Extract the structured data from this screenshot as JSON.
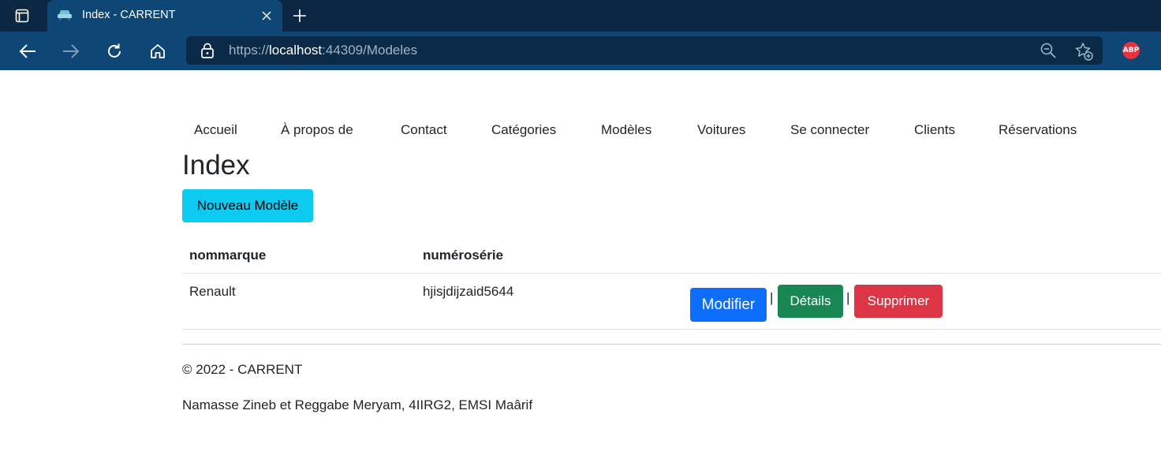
{
  "browser": {
    "tab_title": "Index - CARRENT",
    "url_scheme": "https://",
    "url_host": "localhost",
    "url_rest": ":44309/Modeles",
    "abp_label": "ABP",
    "icons": [
      "tab-actions-icon",
      "car-favicon-icon",
      "close-icon",
      "plus-icon",
      "back-arrow-icon",
      "forward-arrow-icon",
      "refresh-icon",
      "home-icon",
      "lock-icon",
      "zoom-out-icon",
      "favorites-add-icon"
    ]
  },
  "nav": {
    "items": [
      "Accueil",
      "À propos de",
      "Contact",
      "Catégories",
      "Modèles",
      "Voitures",
      "Se connecter",
      "Clients",
      "Réservations"
    ]
  },
  "main": {
    "title": "Index",
    "new_button": "Nouveau Modèle",
    "table": {
      "headers": [
        "nommarque",
        "numérosérie"
      ],
      "rows": [
        {
          "nommarque": "Renault",
          "numeroserie": "hjisjdijzaid5644",
          "edit_label": "Modifier",
          "details_label": "Détails",
          "delete_label": "Supprimer",
          "separator": "|"
        }
      ]
    }
  },
  "footer": {
    "copyright": "© 2022 - CARRENT",
    "credits": "Namasse Zineb et Reggabe Meryam, 4IIRG2, EMSI Maârif"
  },
  "colors": {
    "tabbar": "#0b2744",
    "toolbar": "#0e4675",
    "info": "#0dcaf0",
    "primary": "#0d6efd",
    "success": "#198754",
    "danger": "#dc3545"
  }
}
